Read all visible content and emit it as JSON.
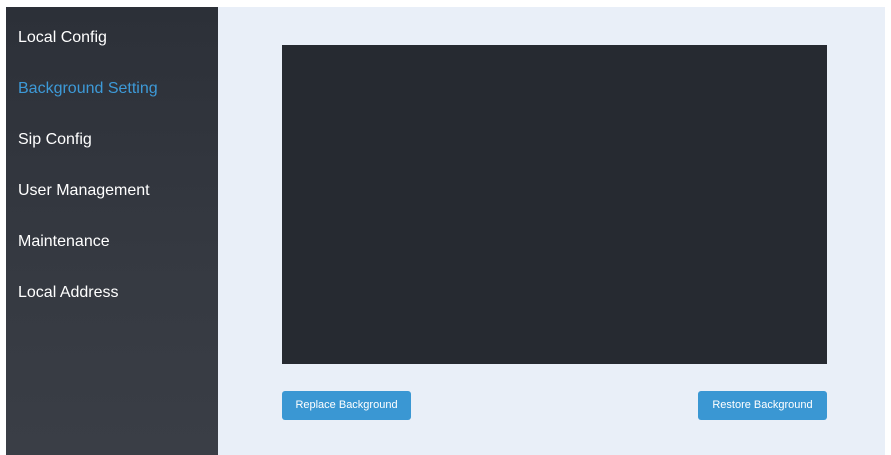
{
  "sidebar": {
    "items": [
      {
        "label": "Local Config",
        "active": false
      },
      {
        "label": "Background Setting",
        "active": true
      },
      {
        "label": "Sip Config",
        "active": false
      },
      {
        "label": "User Management",
        "active": false
      },
      {
        "label": "Maintenance",
        "active": false
      },
      {
        "label": "Local Address",
        "active": false
      }
    ],
    "active_color": "#3d9ad8",
    "background_color": "#353941"
  },
  "main": {
    "background_color": "#e9eff8",
    "preview_color": "#262a31",
    "replace_button_label": "Replace Background",
    "restore_button_label": "Restore Background",
    "button_color": "#3a97d3"
  }
}
